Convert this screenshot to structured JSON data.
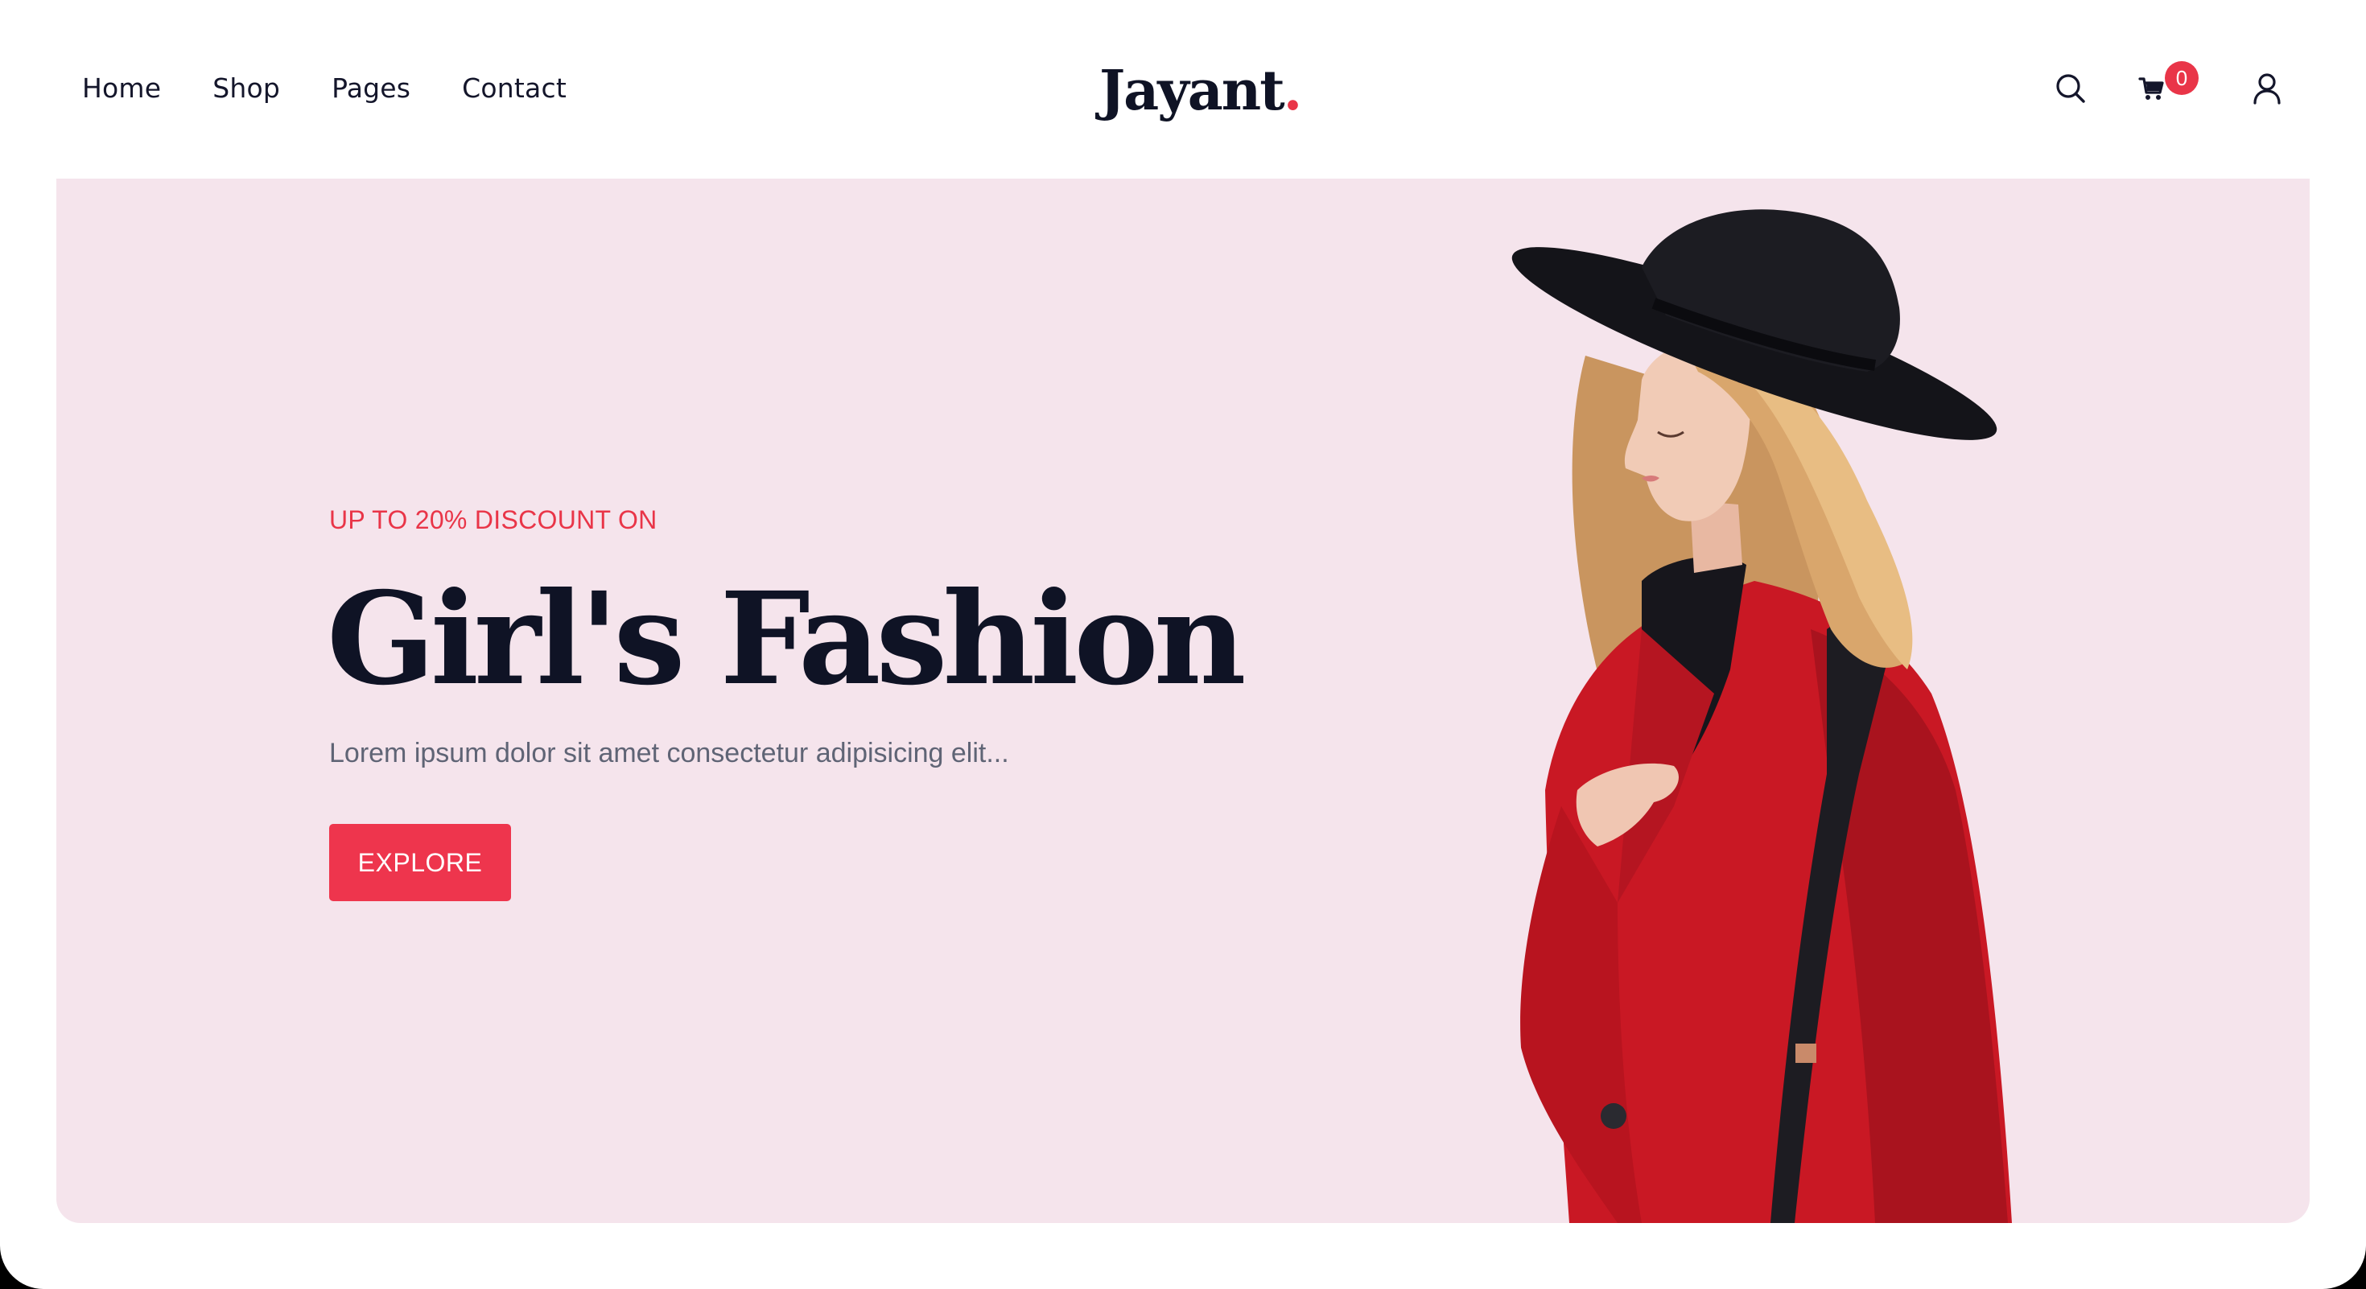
{
  "nav": {
    "items": [
      {
        "label": "Home"
      },
      {
        "label": "Shop"
      },
      {
        "label": "Pages"
      },
      {
        "label": "Contact"
      }
    ]
  },
  "brand": {
    "name": "Jayant",
    "dot": "."
  },
  "header_icons": {
    "search": "search-icon",
    "cart": "cart-icon",
    "account": "user-icon",
    "cart_count": "0"
  },
  "hero": {
    "eyebrow": "UP TO 20% DISCOUNT ON",
    "title": "Girl's Fashion",
    "subtitle": "Lorem ipsum dolor sit amet consectetur adipisicing elit...",
    "cta_label": "EXPLORE",
    "image": "woman-in-red-coat-and-black-hat"
  },
  "colors": {
    "accent": "#e93548",
    "button": "#ee354d",
    "dark_text": "#0f1325",
    "hero_background": "#f5e4ec",
    "body_text": "#5f6475"
  }
}
